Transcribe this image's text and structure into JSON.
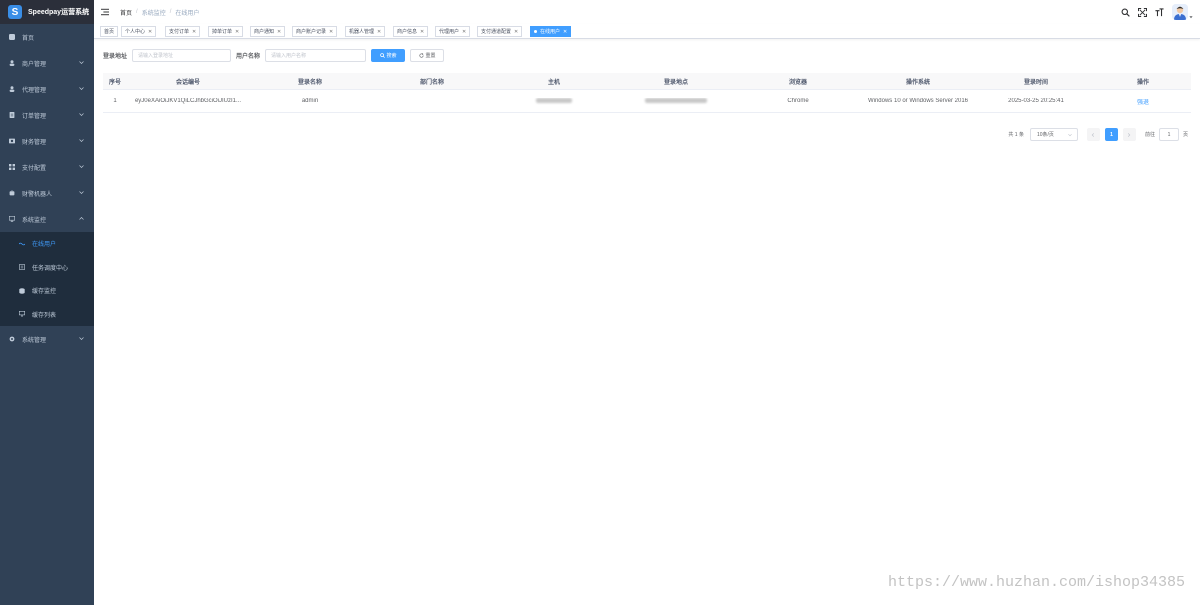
{
  "app": {
    "title": "Speedpay运营系统"
  },
  "sidebar": {
    "items": [
      {
        "label": "首页",
        "icon": "dashboard-icon",
        "has_children": false
      },
      {
        "label": "商户管理",
        "icon": "merchant-icon",
        "has_children": true
      },
      {
        "label": "代理管理",
        "icon": "agent-icon",
        "has_children": true
      },
      {
        "label": "订单管理",
        "icon": "order-icon",
        "has_children": true
      },
      {
        "label": "财务管理",
        "icon": "finance-icon",
        "has_children": true
      },
      {
        "label": "支付配置",
        "icon": "payment-config-icon",
        "has_children": true
      },
      {
        "label": "财警机器人",
        "icon": "robot-icon",
        "has_children": true
      },
      {
        "label": "系统监控",
        "icon": "monitor-icon",
        "has_children": true,
        "expanded": true
      }
    ],
    "submenu": [
      {
        "label": "在线用户",
        "icon": "online-user-icon",
        "active": true
      },
      {
        "label": "任务调度中心",
        "icon": "job-icon",
        "active": false
      },
      {
        "label": "缓存监控",
        "icon": "cache-icon",
        "active": false
      },
      {
        "label": "缓存列表",
        "icon": "cache-list-icon",
        "active": false
      }
    ],
    "after": [
      {
        "label": "系统管理",
        "icon": "settings-icon",
        "has_children": true
      }
    ],
    "colors": {
      "bg": "#304156",
      "submenu_bg": "#1f2d3d",
      "text": "#bfcbd9",
      "active": "#409eff"
    }
  },
  "navbar": {
    "breadcrumb": [
      "首页",
      "系统监控",
      "在线用户"
    ]
  },
  "tags": [
    {
      "label": "首页",
      "closable": false,
      "active": false
    },
    {
      "label": "个人中心",
      "closable": true,
      "active": false
    },
    {
      "label": "支付订单",
      "closable": true,
      "active": false
    },
    {
      "label": "掉单订单",
      "closable": true,
      "active": false
    },
    {
      "label": "商户通知",
      "closable": true,
      "active": false
    },
    {
      "label": "商户账户记录",
      "closable": true,
      "active": false
    },
    {
      "label": "机器人管理",
      "closable": true,
      "active": false
    },
    {
      "label": "商户信息",
      "closable": true,
      "active": false
    },
    {
      "label": "代理用户",
      "closable": true,
      "active": false
    },
    {
      "label": "支付通道配置",
      "closable": true,
      "active": false
    },
    {
      "label": "在线用户",
      "closable": true,
      "active": true
    }
  ],
  "search": {
    "ip_label": "登录地址",
    "ip_placeholder": "请输入登录地址",
    "user_label": "用户名称",
    "user_placeholder": "请输入用户名称",
    "search_btn": "搜索",
    "reset_btn": "重置"
  },
  "table": {
    "columns": [
      "序号",
      "会话编号",
      "登录名称",
      "部门名称",
      "主机",
      "登录地点",
      "浏览器",
      "操作系统",
      "登录时间",
      "操作"
    ],
    "rows": [
      {
        "index": "1",
        "session": "eyJ0eXAiOiJKV1QiLCJhbGciOiJIUzI1...",
        "login_name": "admin",
        "dept": "",
        "host": "",
        "location": "",
        "browser": "Chrome",
        "os": "Windows 10 or Windows Server 2016",
        "login_time": "2025-03-25 20:25:41",
        "action": "强退"
      }
    ]
  },
  "pagination": {
    "total": "共 1 条",
    "page_size": "10条/页",
    "current": "1",
    "goto_prefix": "前往",
    "goto_value": "1",
    "goto_suffix": "页"
  },
  "watermark": "https://www.huzhan.com/ishop34385"
}
